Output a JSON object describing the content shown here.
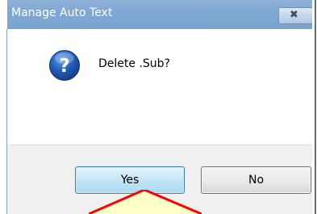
{
  "window": {
    "title": "Manage Auto Text",
    "close_icon": "close-icon"
  },
  "message": {
    "icon": "question-icon",
    "text": "Delete .Sub?"
  },
  "buttons": {
    "yes_label": "Yes",
    "no_label": "No"
  },
  "colors": {
    "titlebar": "#7fa7d2",
    "footer": "#f0f0f0",
    "question_icon": "#1f58b5",
    "callout_fill": "#ffffc8",
    "callout_stroke": "#ff0000"
  }
}
